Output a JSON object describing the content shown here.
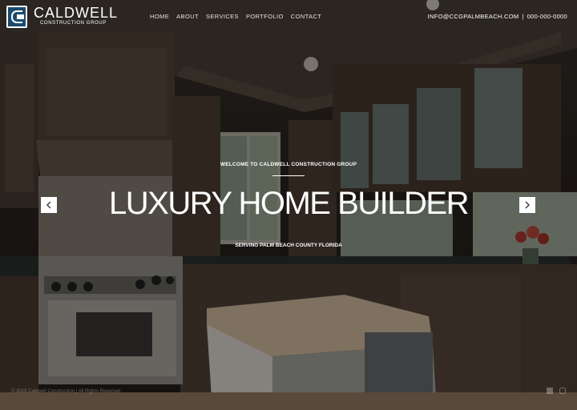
{
  "brand": {
    "title": "CALDWELL",
    "subtitle": "CONSTRUCTION GROUP"
  },
  "nav": {
    "items": [
      "HOME",
      "ABOUT",
      "SERVICES",
      "PORTFOLIO",
      "CONTACT"
    ]
  },
  "contact": {
    "email": "INFO@CCGPALMBEACH.COM",
    "separator": "|",
    "phone": "000-000-0000"
  },
  "hero": {
    "welcome": "WELCOME TO CALDWELL CONSTRUCTION GROUP",
    "headline": "LUXURY HOME BUILDER",
    "serving": "SERVING PALM BEACH COUNTY FLORIDA"
  },
  "slider": {
    "prev_icon": "chevron-left-icon",
    "next_icon": "chevron-right-icon"
  },
  "footer": {
    "copyright": "© 2019 Caldwell Construction | All Rights Reserved"
  },
  "social": {
    "icons": [
      "facebook-icon",
      "instagram-icon"
    ]
  },
  "colors": {
    "logo_blue": "#1b4b6e",
    "overlay": "#000000",
    "text": "#ffffff"
  }
}
